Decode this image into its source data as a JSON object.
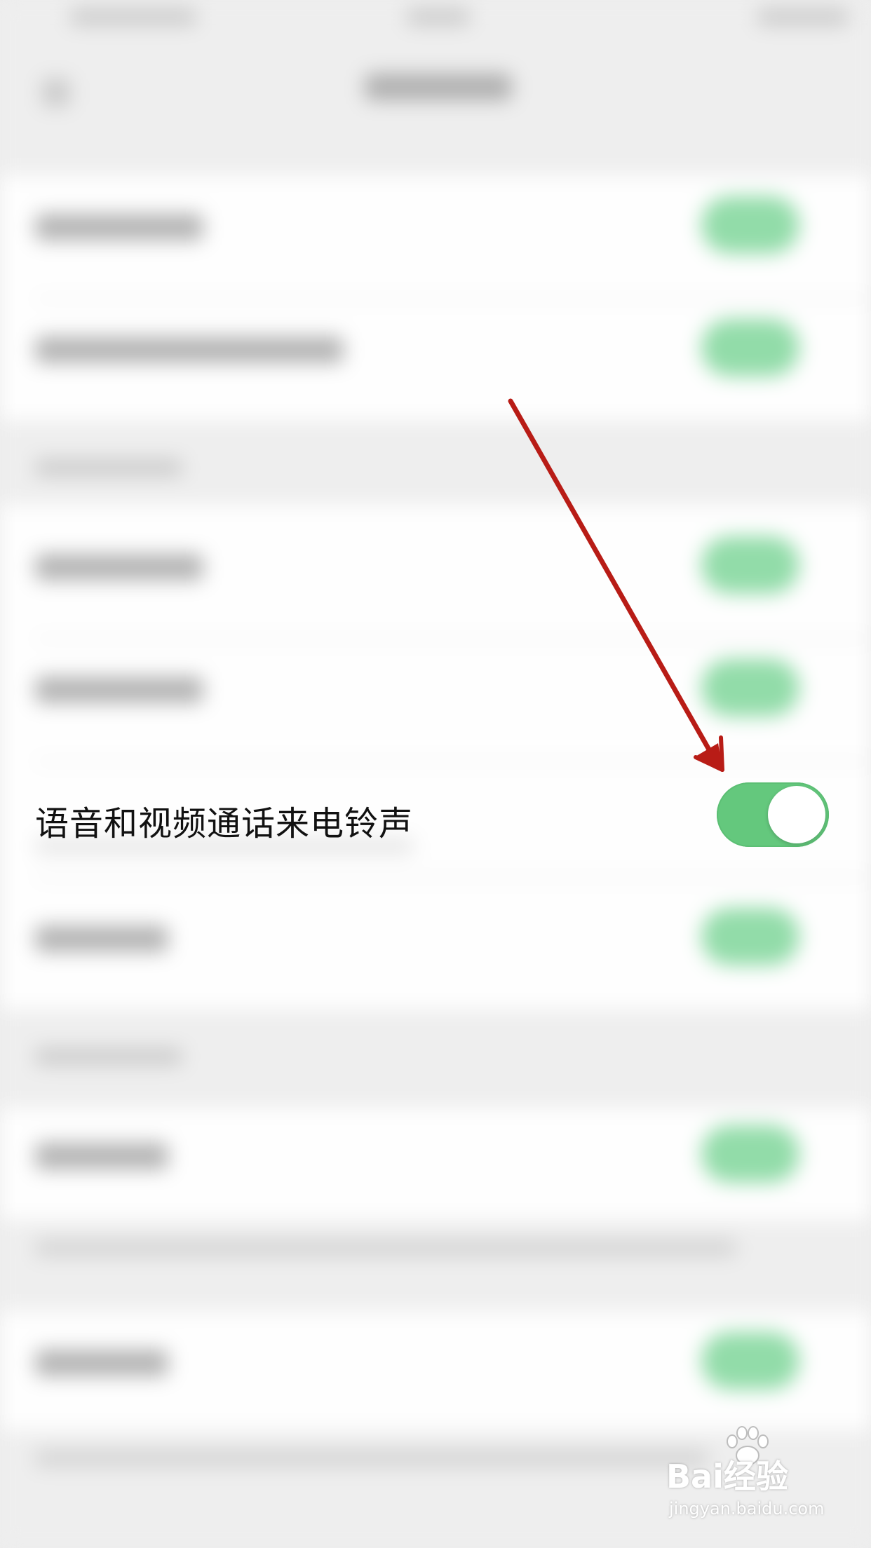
{
  "settings": {
    "highlighted_row": {
      "label": "语音和视频通话来电铃声",
      "toggle_on": true
    }
  },
  "colors": {
    "toggle_on": "#64c87d",
    "arrow": "#b81c16",
    "background": "#ededed"
  },
  "watermark": {
    "brand": "Bai经验",
    "url": "jingyan.baidu.com"
  }
}
